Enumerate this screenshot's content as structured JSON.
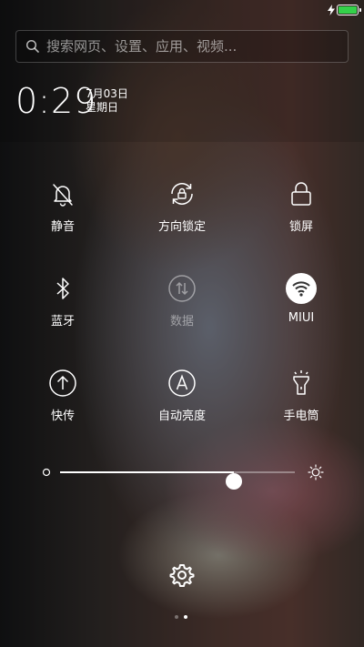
{
  "status_bar": {
    "battery_level": 1.0,
    "charging": true,
    "battery_color": "#34d14a"
  },
  "search": {
    "placeholder": "搜索网页、设置、应用、视频..."
  },
  "clock": {
    "time": "0:29",
    "date": "7月03日",
    "weekday": "星期日"
  },
  "tiles": [
    {
      "label": "静音",
      "icon": "bell-off-icon",
      "active": false
    },
    {
      "label": "方向锁定",
      "icon": "rotation-lock-icon",
      "active": false
    },
    {
      "label": "锁屏",
      "icon": "lock-icon",
      "active": false
    },
    {
      "label": "蓝牙",
      "icon": "bluetooth-icon",
      "active": false
    },
    {
      "label": "数据",
      "icon": "mobile-data-icon",
      "active": false,
      "disabled": true
    },
    {
      "label": "MIUI",
      "icon": "wifi-icon",
      "active": true
    },
    {
      "label": "快传",
      "icon": "quick-transfer-icon",
      "active": false
    },
    {
      "label": "自动亮度",
      "icon": "auto-brightness-icon",
      "active": false
    },
    {
      "label": "手电筒",
      "icon": "flashlight-icon",
      "active": false
    }
  ],
  "brightness": {
    "level": 0.74
  },
  "footer": {
    "settings_icon": "gear-icon",
    "pages": 2,
    "current_page": 2
  }
}
